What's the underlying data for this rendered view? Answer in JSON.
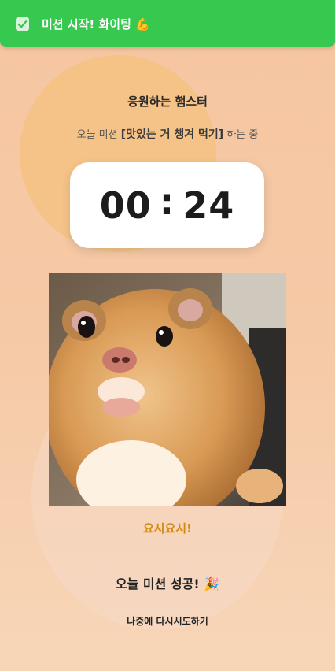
{
  "toast": {
    "message": "미션 시작! 화이팅 💪",
    "icon": "checkbox-checked-icon"
  },
  "header": {
    "title": "응원하는 햄스터",
    "subtitle_prefix": "오늘 미션 ",
    "mission": "[맛있는 거 챙겨 먹기]",
    "subtitle_suffix": " 하는 중"
  },
  "timer": {
    "minutes": "00",
    "separator": ":",
    "seconds": "24"
  },
  "image": {
    "subject": "hamster-photo"
  },
  "cheer_text": "요시요시!",
  "success_button": "오늘 미션 성공! 🎉",
  "retry_button": "나중에 다시시도하기",
  "colors": {
    "toast": "#37c84f",
    "accent": "#d4890f",
    "background": "#f5c6a0"
  }
}
